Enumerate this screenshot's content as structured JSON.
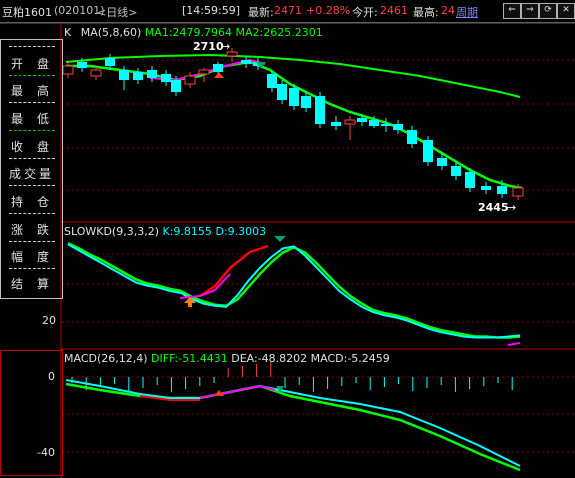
{
  "header": {
    "symbol": "豆粕1601",
    "code": "(020101)",
    "period": "<日线>",
    "time": "[14:59:59]",
    "latest_label": "最新:",
    "latest_value": "2471",
    "change": "+0.28%",
    "open_label": "今开:",
    "open_value": "2461",
    "high_label": "最高:",
    "high_value": "24",
    "cycle_button": "周期",
    "colors": {
      "up": "#ff4040",
      "down": "#00ffff",
      "text": "#c0c0c0",
      "accent": "#ffff00"
    }
  },
  "sidebar": {
    "items": [
      {
        "label": "开盘"
      },
      {
        "label": "最高"
      },
      {
        "label": "最低"
      },
      {
        "label": "收盘"
      },
      {
        "label": "成交量"
      },
      {
        "label": "持仓"
      },
      {
        "label": "涨跌"
      },
      {
        "label": "幅度"
      },
      {
        "label": "结算"
      }
    ]
  },
  "main_panel": {
    "k_label": "K",
    "ma_label": "MA(5,8,60)",
    "ma1": "MA1:2479.7964",
    "ma2": "MA2:2625.2301",
    "high_marker": "2710",
    "low_marker": "2445",
    "colors": {
      "ma1": "#00ff00",
      "ma2": "#00ff00",
      "up": "#ff4040",
      "down": "#00ffff"
    }
  },
  "kd_panel": {
    "name": "SLOWKD(9,3,3,2)",
    "k": "K:9.8155",
    "d": "D:9.3003",
    "axis_label": "20",
    "k_values": [
      96,
      90,
      84,
      78,
      72,
      66,
      60,
      57,
      55,
      52,
      50,
      44,
      40,
      38,
      37,
      48,
      62,
      74,
      84,
      92,
      94,
      85,
      74,
      63,
      52,
      44,
      37,
      32,
      29,
      27,
      24,
      20,
      16,
      13,
      11,
      9,
      8,
      8,
      8,
      9,
      10
    ],
    "d_values": [
      97,
      92,
      86,
      81,
      75,
      69,
      63,
      59,
      57,
      54,
      52,
      46,
      42,
      39,
      38,
      44,
      56,
      68,
      79,
      88,
      93,
      88,
      78,
      67,
      56,
      47,
      40,
      34,
      31,
      29,
      26,
      22,
      18,
      15,
      13,
      11,
      9,
      9,
      8,
      8,
      9
    ]
  },
  "macd_panel": {
    "name": "MACD(26,12,4)",
    "diff": "DIFF:-51.4431",
    "dea": "DEA:-48.8202",
    "macd": "MACD:-5.2459",
    "axis_top": "0",
    "axis_bottom": "-40"
  }
}
